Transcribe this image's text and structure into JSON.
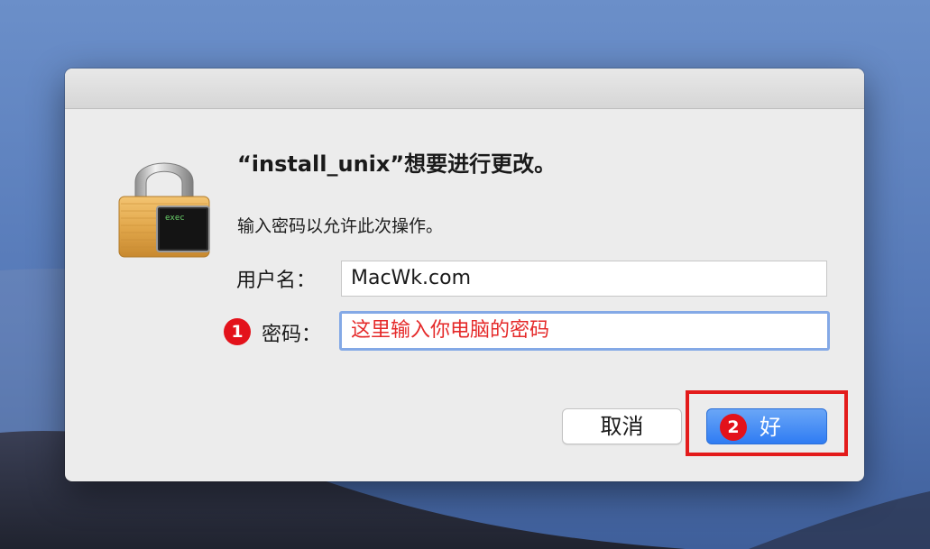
{
  "dialog": {
    "title": "“install_unix”想要进行更改。",
    "message": "输入密码以允许此次操作。",
    "lock_badge_text": "exec",
    "username_label": "用户名：",
    "username_value": "MacWk.com",
    "password_label": "密码：",
    "password_value": "这里输入你电脑的密码",
    "cancel_label": "取消",
    "ok_label": "好"
  },
  "annotations": {
    "step1": "1",
    "step2": "2"
  },
  "colors": {
    "accent_blue": "#2f7cf3",
    "annotation_red": "#e3121b",
    "focus_ring": "#84a9e6",
    "password_text": "#e52a2a"
  },
  "icons": {
    "lock": "padlock-exec-icon"
  }
}
